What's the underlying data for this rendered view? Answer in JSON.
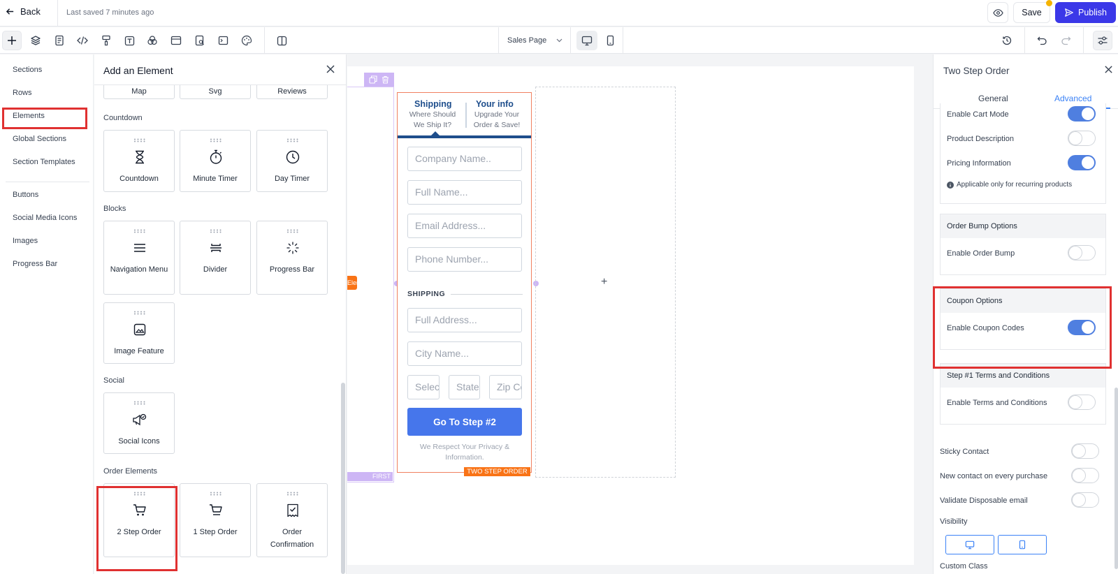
{
  "topbar": {
    "back_label": "Back",
    "last_saved": "Last saved 7 minutes ago",
    "save_label": "Save",
    "publish_label": "Publish"
  },
  "toolbar": {
    "page_select": "Sales Page",
    "tool_icons": [
      "plus-icon",
      "layers-icon",
      "page-icon",
      "code-icon",
      "paint-roller-icon",
      "text-icon",
      "blend-icon",
      "layout-icon",
      "file-search-icon",
      "terminal-icon",
      "palette-icon",
      "split-view-icon"
    ],
    "device_icons": [
      "desktop-icon",
      "mobile-icon"
    ],
    "right_icons": [
      "history-icon",
      "undo-icon",
      "redo-icon",
      "settings-sliders-icon"
    ]
  },
  "leftnav": {
    "items": [
      "Sections",
      "Rows",
      "Elements",
      "Global Sections",
      "Section Templates",
      "Buttons",
      "Social Media Icons",
      "Images",
      "Progress Bar"
    ],
    "selected": "Elements"
  },
  "element_panel": {
    "title": "Add an Element",
    "top_cards": [
      "Map",
      "Svg",
      "Reviews"
    ],
    "categories": {
      "countdown": "Countdown",
      "blocks": "Blocks",
      "social": "Social",
      "order": "Order Elements"
    },
    "countdown_items": [
      "Countdown",
      "Minute Timer",
      "Day Timer"
    ],
    "block_items": [
      "Navigation Menu",
      "Divider",
      "Progress Bar",
      "Image Feature"
    ],
    "social_items": [
      "Social Icons"
    ],
    "order_items": [
      "2 Step Order",
      "1 Step Order",
      "Order Confirmation"
    ]
  },
  "canvas": {
    "column_label": "FIRST COLUMN",
    "element_label": "TWO STEP ORDER",
    "orange_tag": "Element",
    "form": {
      "tab1_title": "Shipping",
      "tab1_sub": "Where Should We Ship It?",
      "tab2_title": "Your info",
      "tab2_sub": "Upgrade Your Order & Save!",
      "fields": [
        "Company Name..",
        "Full Name...",
        "Email Address...",
        "Phone Number..."
      ],
      "shipping_heading": "SHIPPING",
      "address_fields": [
        "Full Address...",
        "City Name..."
      ],
      "small_fields": [
        "Select Country",
        "State",
        "Zip Code"
      ],
      "button": "Go To Step #2",
      "privacy": "We Respect Your Privacy & Information."
    }
  },
  "right_panel": {
    "title": "Two Step Order",
    "tabs": [
      "General",
      "Advanced"
    ],
    "active_tab": "Advanced",
    "cart": {
      "enable_cart_mode": "Enable Cart Mode",
      "product_description": "Product Description",
      "pricing_information": "Pricing Information",
      "note": "Applicable only for recurring products",
      "cart_mode_on": true,
      "product_description_on": false,
      "pricing_information_on": true
    },
    "order_bump": {
      "heading": "Order Bump Options",
      "enable": "Enable Order Bump",
      "on": false
    },
    "coupon": {
      "heading": "Coupon Options",
      "enable": "Enable Coupon Codes",
      "on": true
    },
    "terms": {
      "heading": "Step #1 Terms and Conditions",
      "enable": "Enable Terms and Conditions",
      "on": false
    },
    "loose": {
      "sticky_contact": "Sticky Contact",
      "new_contact": "New contact on every purchase",
      "validate_email": "Validate Disposable email"
    },
    "visibility_label": "Visibility",
    "custom_class_label": "Custom Class"
  },
  "colors": {
    "accent": "#3b38e8",
    "highlight": "#e03131",
    "form_border": "#f08060",
    "form_blue": "#1e4e8c",
    "button_blue": "#4676eb",
    "column_purple": "#cdb6f5",
    "tag_orange": "#f97316",
    "toggle_on": "#4f7fe0"
  }
}
